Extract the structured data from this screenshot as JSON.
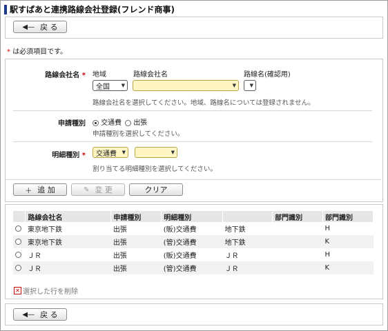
{
  "title": "駅すぱあと連携路線会社登録(フレンド商事)",
  "back_label": "戻 る",
  "required_note": "は必須項目です。",
  "required_mark": "*",
  "company": {
    "label": "路線会社名",
    "region_header": "地域",
    "company_header": "路線会社名",
    "line_header": "路線名(確認用)",
    "region_value": "全国",
    "company_value": "",
    "line_value": "",
    "help": "路線会社名を選択してください。地域、路線名については登録されません。"
  },
  "apply": {
    "label": "申請種別",
    "options": [
      "交通費",
      "出張"
    ],
    "selected": "交通費",
    "help": "申請種別を選択してください。"
  },
  "detail": {
    "label": "明細種別",
    "type_value": "交通費",
    "sub_value": "",
    "help": "割り当てる明細種別を選択してください。"
  },
  "actions": {
    "add": "追 加",
    "edit": "変 更",
    "clear": "クリア"
  },
  "table": {
    "headers": [
      "路線会社名",
      "申請種別",
      "明細種別",
      "",
      "部門識別",
      "部門識別"
    ],
    "rows": [
      [
        "東京地下鉄",
        "出張",
        "(販)交通費",
        "地下鉄",
        "",
        "H"
      ],
      [
        "東京地下鉄",
        "出張",
        "(管)交通費",
        "地下鉄",
        "",
        "K"
      ],
      [
        "ＪＲ",
        "出張",
        "(販)交通費",
        "ＪＲ",
        "",
        "H"
      ],
      [
        "ＪＲ",
        "出張",
        "(管)交通費",
        "ＪＲ",
        "",
        "K"
      ]
    ]
  },
  "delete_label": "選択した行を削除"
}
